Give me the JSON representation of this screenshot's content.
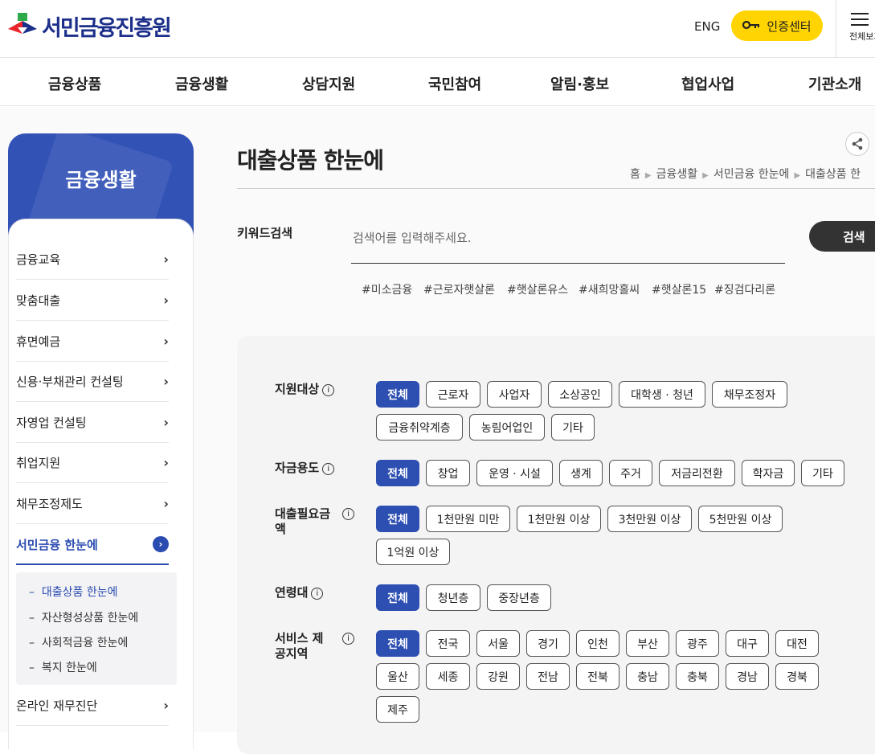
{
  "header": {
    "logo_text": "서민금융진흥원",
    "lang_label": "ENG",
    "cert_label": "인증센터",
    "allmenu_label": "전체보기"
  },
  "gnb": [
    "금융상품",
    "금융생활",
    "상담지원",
    "국민참여",
    "알림·홍보",
    "협업사업",
    "기관소개"
  ],
  "sidebar": {
    "title": "금융생활",
    "items": [
      "금융교육",
      "맞춤대출",
      "휴면예금",
      "신용·부채관리 컨설팅",
      "자영업 컨설팅",
      "취업지원",
      "채무조정제도",
      "서민금융 한눈에",
      "온라인 재무진단"
    ],
    "sub_items": [
      "대출상품 한눈에",
      "자산형성상품 한눈에",
      "사회적금융 한눈에",
      "복지 한눈에"
    ]
  },
  "page": {
    "title": "대출상품 한눈에",
    "breadcrumb": [
      "홈",
      "금융생활",
      "서민금융 한눈에",
      "대출상품 한"
    ]
  },
  "search": {
    "label": "키워드검색",
    "placeholder": "검색어를 입력해주세요.",
    "value": "",
    "button": "검색",
    "tags": [
      "#미소금융",
      "#근로자햇살론",
      "#햇살론유스",
      "#새희망홀씨",
      "#햇살론15",
      "#징검다리론"
    ]
  },
  "filters": [
    {
      "label": "지원대상",
      "options": [
        "전체",
        "근로자",
        "사업자",
        "소상공인",
        "대학생 · 청년",
        "채무조정자",
        "금융취약계층",
        "농림어업인",
        "기타"
      ],
      "selected": "전체"
    },
    {
      "label": "자금용도",
      "options": [
        "전체",
        "창업",
        "운영 · 시설",
        "생계",
        "주거",
        "저금리전환",
        "학자금",
        "기타"
      ],
      "selected": "전체"
    },
    {
      "label": "대출필요금액",
      "options": [
        "전체",
        "1천만원 미만",
        "1천만원 이상",
        "3천만원 이상",
        "5천만원 이상",
        "1억원 이상"
      ],
      "selected": "전체"
    },
    {
      "label": "연령대",
      "options": [
        "전체",
        "청년층",
        "중장년층"
      ],
      "selected": "전체"
    },
    {
      "label": "서비스 제공지역",
      "options": [
        "전체",
        "전국",
        "서울",
        "경기",
        "인천",
        "부산",
        "광주",
        "대구",
        "대전",
        "울산",
        "세종",
        "강원",
        "전남",
        "전북",
        "충남",
        "충북",
        "경남",
        "경북",
        "제주"
      ],
      "selected": "전체"
    }
  ],
  "colors": {
    "brand": "#2d4fb1",
    "cert": "#ffd400"
  }
}
